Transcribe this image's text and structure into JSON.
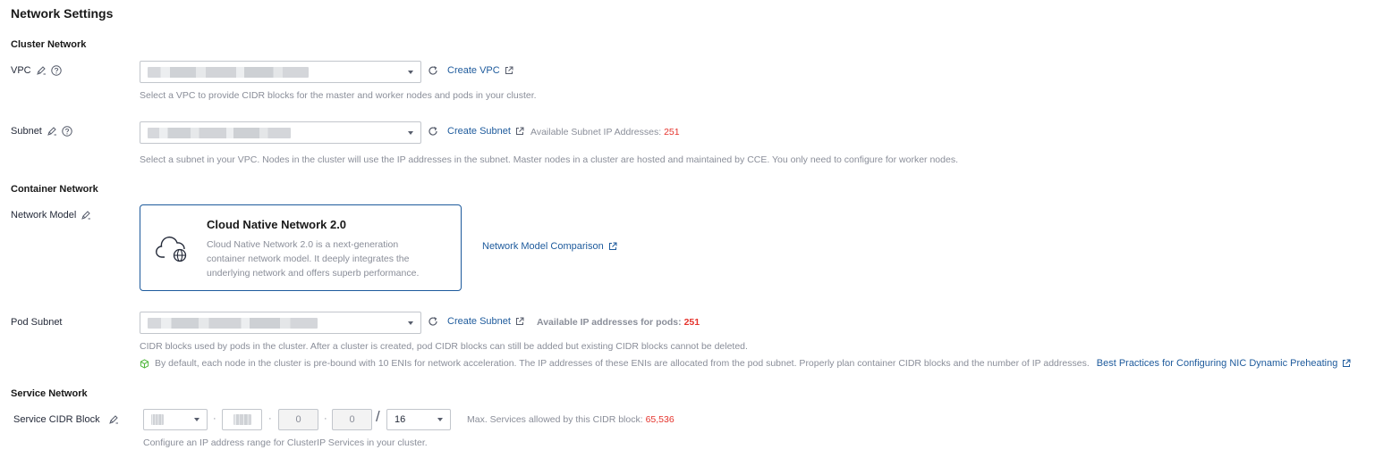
{
  "page": {
    "title": "Network Settings"
  },
  "cluster_network": {
    "heading": "Cluster Network",
    "vpc": {
      "label": "VPC",
      "create_link": "Create VPC",
      "hint": "Select a VPC to provide CIDR blocks for the master and worker nodes and pods in your cluster."
    },
    "subnet": {
      "label": "Subnet",
      "create_link": "Create Subnet",
      "available_label": "Available Subnet IP Addresses:",
      "available_value": "251",
      "hint": "Select a subnet in your VPC. Nodes in the cluster will use the IP addresses in the subnet. Master nodes in a cluster are hosted and maintained by CCE. You only need to configure for worker nodes."
    }
  },
  "container_network": {
    "heading": "Container Network",
    "network_model": {
      "label": "Network Model",
      "card_title": "Cloud Native Network 2.0",
      "card_desc": "Cloud Native Network 2.0 is a next-generation container network model. It deeply integrates the underlying network and offers superb performance.",
      "comparison_link": "Network Model Comparison"
    },
    "pod_subnet": {
      "label": "Pod Subnet",
      "create_link": "Create Subnet",
      "available_label": "Available IP addresses for pods:",
      "available_value": "251",
      "hint": "CIDR blocks used by pods in the cluster. After a cluster is created, pod CIDR blocks can still be added but existing CIDR blocks cannot be deleted.",
      "tip": "By default, each node in the cluster is pre-bound with 10 ENIs for network acceleration. The IP addresses of these ENIs are allocated from the pod subnet. Properly plan container CIDR blocks and the number of IP addresses.",
      "tip_link": "Best Practices for Configuring NIC Dynamic Preheating"
    }
  },
  "service_network": {
    "heading": "Service Network",
    "cidr": {
      "label": "Service CIDR Block",
      "octet3": "0",
      "octet4": "0",
      "slash": "/",
      "mask": "16",
      "max_label": "Max. Services allowed by this CIDR block:",
      "max_value": "65,536",
      "hint": "Configure an IP address range for ClusterIP Services in your cluster."
    }
  },
  "colors": {
    "link": "#1d5a9c",
    "highlight": "#e5342d",
    "border": "#c2c6cc"
  },
  "icons": [
    "edit-pen-icon",
    "help-circle-icon",
    "refresh-icon",
    "external-link-icon",
    "cloud-network-icon",
    "tip-cube-icon"
  ]
}
